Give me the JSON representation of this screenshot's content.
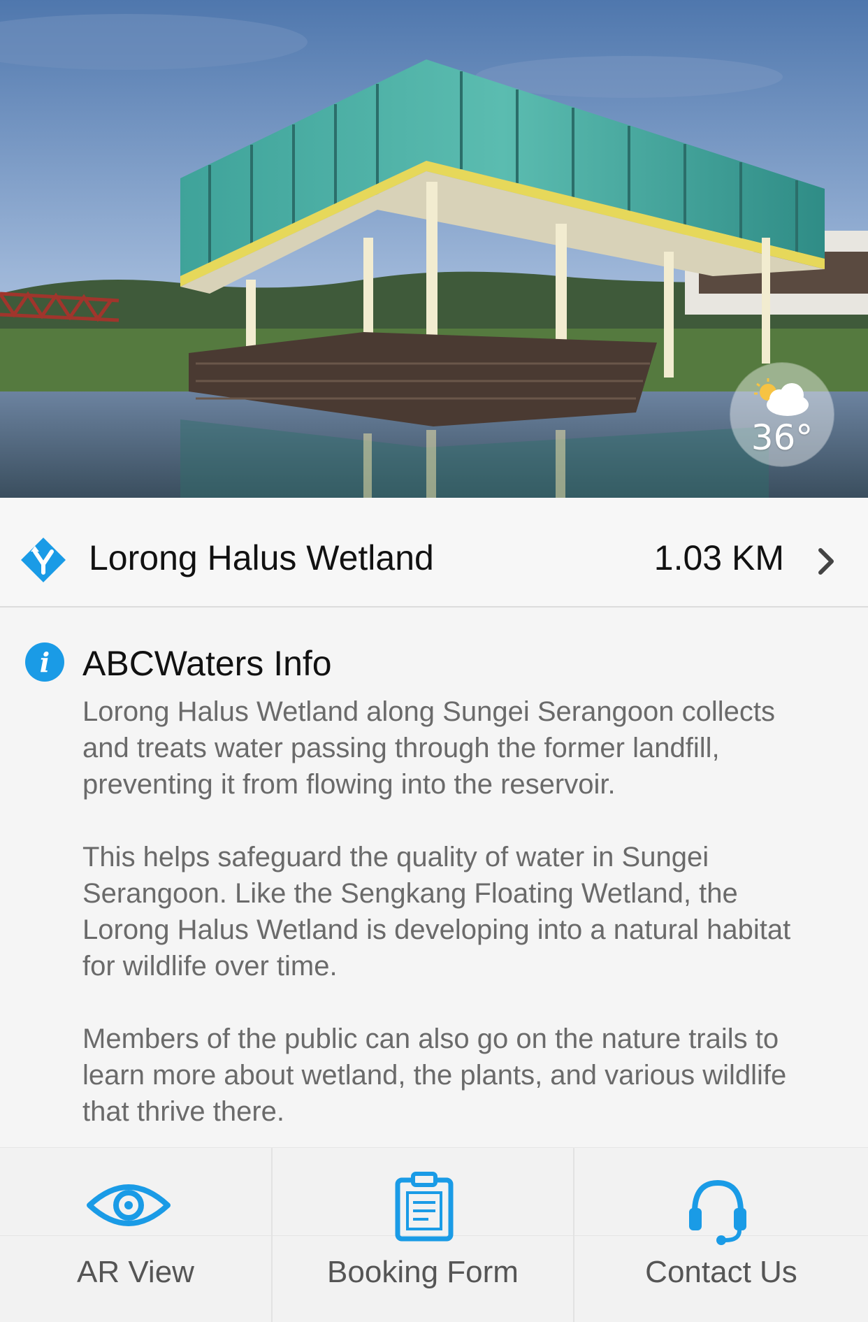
{
  "hero": {
    "image": "lorong-halus-wetland-pavilion-photo",
    "weather": {
      "icon": "partly-cloudy-icon",
      "temperature": "36°"
    }
  },
  "location": {
    "icon": "directions-icon",
    "name": "Lorong Halus Wetland",
    "distance": "1.03 KM",
    "chevron_icon": "chevron-right-icon"
  },
  "info": {
    "icon": "info-icon",
    "title": "ABCWaters Info",
    "paragraphs": [
      "Lorong Halus Wetland along Sungei Serangoon collects and treats water passing through the former landfill, preventing it from flowing into the reservoir.",
      "This helps safeguard the quality of water in Sungei Serangoon. Like the Sengkang Floating Wetland, the Lorong Halus Wetland is developing into a natural habitat for wildlife over time.",
      "Members of the public can also go on the nature trails to learn more about wetland, the plants, and various wildlife that thrive there."
    ]
  },
  "actions": [
    {
      "label": "AR View",
      "icon": "eye-icon"
    },
    {
      "label": "Booking Form",
      "icon": "clipboard-icon"
    },
    {
      "label": "Contact Us",
      "icon": "headset-icon"
    }
  ],
  "colors": {
    "accent": "#1a9be6",
    "text_dark": "#111111",
    "text_body": "#6a6a6a"
  }
}
